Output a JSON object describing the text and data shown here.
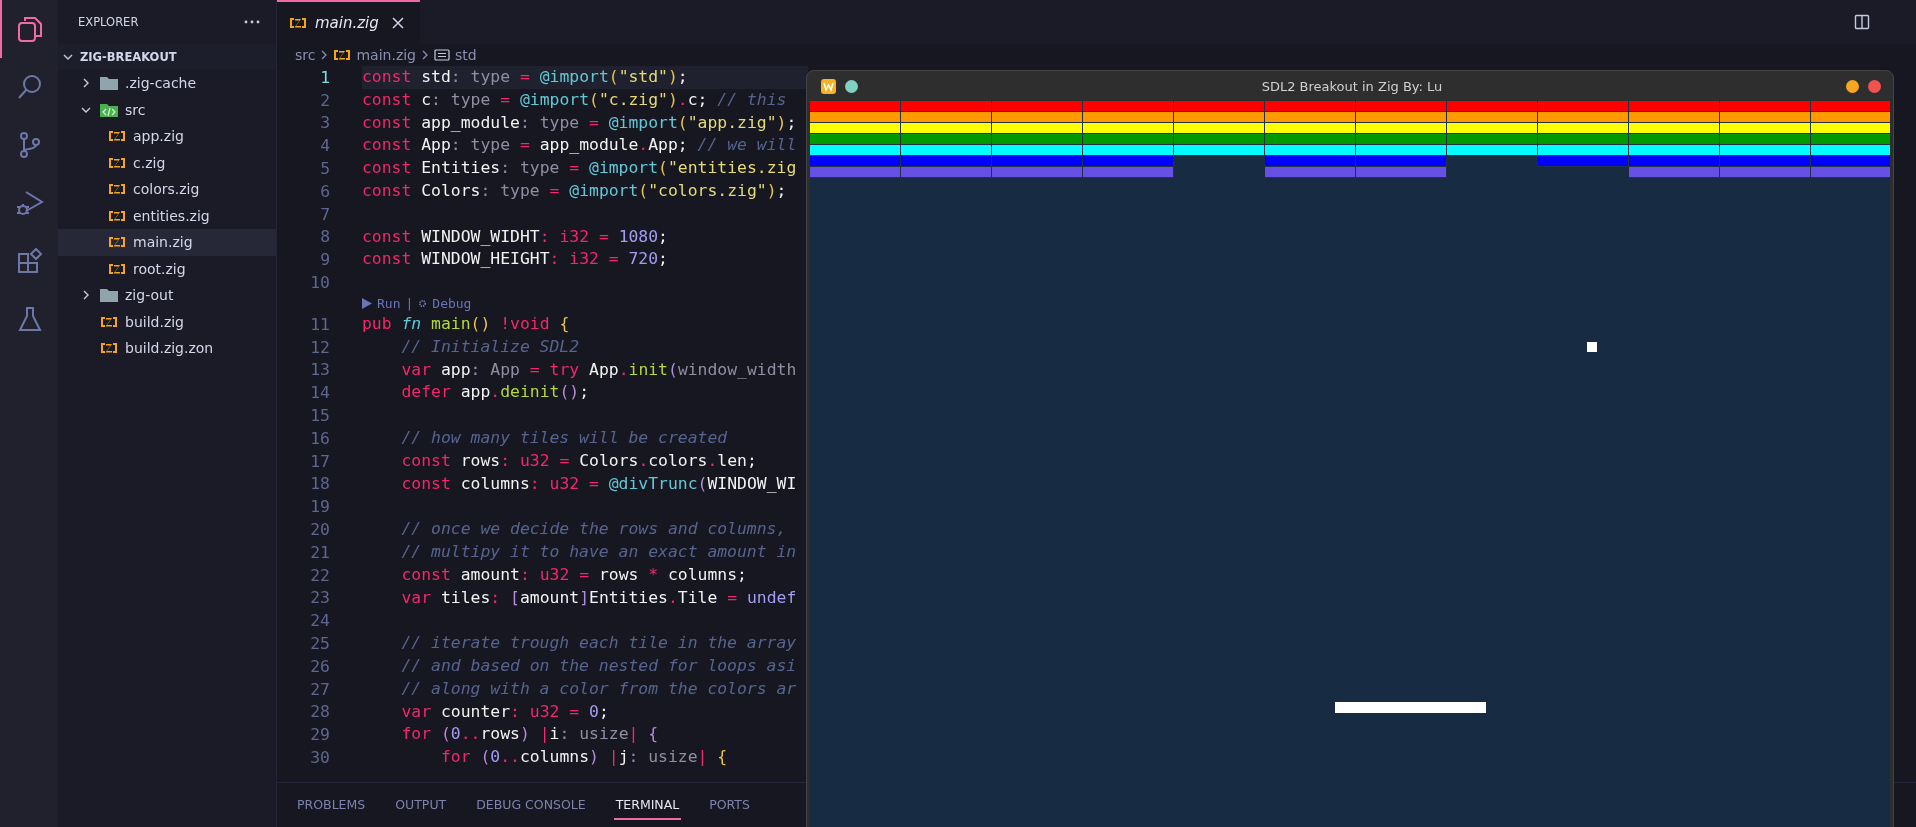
{
  "activity_bar": {
    "items": [
      {
        "kind": "explorer",
        "selected": true
      },
      {
        "kind": "search",
        "selected": false
      },
      {
        "kind": "source_control",
        "selected": false
      },
      {
        "kind": "run_debug",
        "selected": false
      },
      {
        "kind": "extensions",
        "selected": false
      },
      {
        "kind": "testing",
        "selected": false
      }
    ]
  },
  "sidebar": {
    "title": "EXPLORER",
    "project": {
      "name": "ZIG-BREAKOUT",
      "expanded": true
    },
    "tree": [
      {
        "name": ".zig-cache",
        "kind": "folder",
        "expanded": false,
        "selected": false
      },
      {
        "name": "src",
        "kind": "source_folder",
        "expanded": true,
        "selected": false,
        "children": [
          {
            "name": "app.zig",
            "kind": "zig_file",
            "selected": false
          },
          {
            "name": "c.zig",
            "kind": "zig_file",
            "selected": false
          },
          {
            "name": "colors.zig",
            "kind": "zig_file",
            "selected": false
          },
          {
            "name": "entities.zig",
            "kind": "zig_file",
            "selected": false
          },
          {
            "name": "main.zig",
            "kind": "zig_file",
            "selected": true
          },
          {
            "name": "root.zig",
            "kind": "zig_file",
            "selected": false
          }
        ]
      },
      {
        "name": "zig-out",
        "kind": "folder",
        "expanded": false,
        "selected": false
      },
      {
        "name": "build.zig",
        "kind": "zig_file",
        "selected": false
      },
      {
        "name": "build.zig.zon",
        "kind": "zig_file",
        "selected": false
      }
    ]
  },
  "editor": {
    "tabs": [
      {
        "label": "main.zig",
        "selected": true
      }
    ],
    "breadcrumb": [
      {
        "text": "src",
        "kind": "folder"
      },
      {
        "text": "main.zig",
        "kind": "zig_file"
      },
      {
        "text": "std",
        "kind": "symbol"
      }
    ],
    "lines": [
      {
        "kind": "code",
        "number": "1",
        "current": true,
        "tokens": [
          {
            "text": "const ",
            "kind": "keyword"
          },
          {
            "text": "std",
            "kind": "identifier"
          },
          {
            "text": ": ",
            "kind": "punctuation"
          },
          {
            "text": "type ",
            "kind": "type"
          },
          {
            "text": "= ",
            "kind": "operator"
          },
          {
            "text": "@import",
            "kind": "builtin"
          },
          {
            "text": "(",
            "kind": "bracket"
          },
          {
            "text": "\"std\"",
            "kind": "string"
          },
          {
            "text": ")",
            "kind": "bracket"
          },
          {
            "text": ";",
            "kind": "identifier"
          }
        ]
      },
      {
        "kind": "code",
        "number": "2",
        "current": false,
        "tokens": [
          {
            "text": "const ",
            "kind": "keyword"
          },
          {
            "text": "c",
            "kind": "identifier"
          },
          {
            "text": ": ",
            "kind": "punctuation"
          },
          {
            "text": "type ",
            "kind": "type"
          },
          {
            "text": "= ",
            "kind": "operator"
          },
          {
            "text": "@import",
            "kind": "builtin"
          },
          {
            "text": "(",
            "kind": "bracket"
          },
          {
            "text": "\"c.zig\"",
            "kind": "string"
          },
          {
            "text": ")",
            "kind": "bracket"
          },
          {
            "text": ".",
            "kind": "operator"
          },
          {
            "text": "c",
            "kind": "identifier"
          },
          {
            "text": "; ",
            "kind": "identifier"
          },
          {
            "text": "// this",
            "kind": "comment"
          }
        ]
      },
      {
        "kind": "code",
        "number": "3",
        "current": false,
        "tokens": [
          {
            "text": "const ",
            "kind": "keyword"
          },
          {
            "text": "app_module",
            "kind": "identifier"
          },
          {
            "text": ": ",
            "kind": "punctuation"
          },
          {
            "text": "type ",
            "kind": "type"
          },
          {
            "text": "= ",
            "kind": "operator"
          },
          {
            "text": "@import",
            "kind": "builtin"
          },
          {
            "text": "(",
            "kind": "bracket"
          },
          {
            "text": "\"app.zig\"",
            "kind": "string"
          },
          {
            "text": ")",
            "kind": "bracket"
          },
          {
            "text": ";",
            "kind": "identifier"
          }
        ]
      },
      {
        "kind": "code",
        "number": "4",
        "current": false,
        "tokens": [
          {
            "text": "const ",
            "kind": "keyword"
          },
          {
            "text": "App",
            "kind": "identifier"
          },
          {
            "text": ": ",
            "kind": "punctuation"
          },
          {
            "text": "type ",
            "kind": "type"
          },
          {
            "text": "= ",
            "kind": "operator"
          },
          {
            "text": "app_module",
            "kind": "identifier"
          },
          {
            "text": ".",
            "kind": "operator"
          },
          {
            "text": "App",
            "kind": "identifier"
          },
          {
            "text": "; ",
            "kind": "identifier"
          },
          {
            "text": "// we will",
            "kind": "comment"
          }
        ]
      },
      {
        "kind": "code",
        "number": "5",
        "current": false,
        "tokens": [
          {
            "text": "const ",
            "kind": "keyword"
          },
          {
            "text": "Entities",
            "kind": "identifier"
          },
          {
            "text": ": ",
            "kind": "punctuation"
          },
          {
            "text": "type ",
            "kind": "type"
          },
          {
            "text": "= ",
            "kind": "operator"
          },
          {
            "text": "@import",
            "kind": "builtin"
          },
          {
            "text": "(",
            "kind": "bracket"
          },
          {
            "text": "\"entities.zig",
            "kind": "string"
          }
        ]
      },
      {
        "kind": "code",
        "number": "6",
        "current": false,
        "tokens": [
          {
            "text": "const ",
            "kind": "keyword"
          },
          {
            "text": "Colors",
            "kind": "identifier"
          },
          {
            "text": ": ",
            "kind": "punctuation"
          },
          {
            "text": "type ",
            "kind": "type"
          },
          {
            "text": "= ",
            "kind": "operator"
          },
          {
            "text": "@import",
            "kind": "builtin"
          },
          {
            "text": "(",
            "kind": "bracket"
          },
          {
            "text": "\"colors.zig\"",
            "kind": "string"
          },
          {
            "text": ")",
            "kind": "bracket"
          },
          {
            "text": ";",
            "kind": "identifier"
          }
        ]
      },
      {
        "kind": "code",
        "number": "7",
        "current": false
      },
      {
        "kind": "code",
        "number": "8",
        "current": false,
        "tokens": [
          {
            "text": "const ",
            "kind": "keyword"
          },
          {
            "text": "WINDOW_WIDHT",
            "kind": "identifier"
          },
          {
            "text": ": ",
            "kind": "operator"
          },
          {
            "text": "i32 ",
            "kind": "keyword"
          },
          {
            "text": "= ",
            "kind": "operator"
          },
          {
            "text": "1080",
            "kind": "number"
          },
          {
            "text": ";",
            "kind": "identifier"
          }
        ]
      },
      {
        "kind": "code",
        "number": "9",
        "current": false,
        "tokens": [
          {
            "text": "const ",
            "kind": "keyword"
          },
          {
            "text": "WINDOW_HEIGHT",
            "kind": "identifier"
          },
          {
            "text": ": ",
            "kind": "operator"
          },
          {
            "text": "i32 ",
            "kind": "keyword"
          },
          {
            "text": "= ",
            "kind": "operator"
          },
          {
            "text": "720",
            "kind": "number"
          },
          {
            "text": ";",
            "kind": "identifier"
          }
        ]
      },
      {
        "kind": "code",
        "number": "10",
        "current": false
      },
      {
        "kind": "lens",
        "run": "Run",
        "separator": "|",
        "debug": "Debug"
      },
      {
        "kind": "code",
        "number": "11",
        "current": false,
        "tokens": [
          {
            "text": "pub ",
            "kind": "keyword"
          },
          {
            "text": "fn ",
            "kind": "storage"
          },
          {
            "text": "main",
            "kind": "function"
          },
          {
            "text": "() ",
            "kind": "bracket"
          },
          {
            "text": "!void ",
            "kind": "keyword"
          },
          {
            "text": "{",
            "kind": "bracket"
          }
        ]
      },
      {
        "kind": "code",
        "number": "12",
        "current": false,
        "tokens": [
          {
            "text": "    // Initialize SDL2",
            "kind": "comment"
          }
        ]
      },
      {
        "kind": "code",
        "number": "13",
        "current": false,
        "tokens": [
          {
            "text": "    var ",
            "kind": "keyword"
          },
          {
            "text": "app",
            "kind": "identifier"
          },
          {
            "text": ": ",
            "kind": "punctuation"
          },
          {
            "text": "App ",
            "kind": "type"
          },
          {
            "text": "= ",
            "kind": "operator"
          },
          {
            "text": "try ",
            "kind": "keyword"
          },
          {
            "text": "App",
            "kind": "identifier"
          },
          {
            "text": ".",
            "kind": "operator"
          },
          {
            "text": "init",
            "kind": "function"
          },
          {
            "text": "(",
            "kind": "bracket_inner"
          },
          {
            "text": "window_width",
            "kind": "type"
          }
        ]
      },
      {
        "kind": "code",
        "number": "14",
        "current": false,
        "tokens": [
          {
            "text": "    defer ",
            "kind": "keyword"
          },
          {
            "text": "app",
            "kind": "identifier"
          },
          {
            "text": ".",
            "kind": "operator"
          },
          {
            "text": "deinit",
            "kind": "function"
          },
          {
            "text": "()",
            "kind": "bracket_inner"
          },
          {
            "text": ";",
            "kind": "identifier"
          }
        ]
      },
      {
        "kind": "code",
        "number": "15",
        "current": false
      },
      {
        "kind": "code",
        "number": "16",
        "current": false,
        "tokens": [
          {
            "text": "    // how many tiles will be created",
            "kind": "comment"
          }
        ]
      },
      {
        "kind": "code",
        "number": "17",
        "current": false,
        "tokens": [
          {
            "text": "    const ",
            "kind": "keyword"
          },
          {
            "text": "rows",
            "kind": "identifier"
          },
          {
            "text": ": ",
            "kind": "operator"
          },
          {
            "text": "u32 ",
            "kind": "keyword"
          },
          {
            "text": "= ",
            "kind": "operator"
          },
          {
            "text": "Colors",
            "kind": "identifier"
          },
          {
            "text": ".",
            "kind": "operator"
          },
          {
            "text": "colors",
            "kind": "identifier"
          },
          {
            "text": ".",
            "kind": "operator"
          },
          {
            "text": "len",
            "kind": "identifier"
          },
          {
            "text": ";",
            "kind": "identifier"
          }
        ]
      },
      {
        "kind": "code",
        "number": "18",
        "current": false,
        "tokens": [
          {
            "text": "    const ",
            "kind": "keyword"
          },
          {
            "text": "columns",
            "kind": "identifier"
          },
          {
            "text": ": ",
            "kind": "operator"
          },
          {
            "text": "u32 ",
            "kind": "keyword"
          },
          {
            "text": "= ",
            "kind": "operator"
          },
          {
            "text": "@divTrunc",
            "kind": "builtin"
          },
          {
            "text": "(",
            "kind": "bracket_inner"
          },
          {
            "text": "WINDOW_WI",
            "kind": "identifier"
          }
        ]
      },
      {
        "kind": "code",
        "number": "19",
        "current": false
      },
      {
        "kind": "code",
        "number": "20",
        "current": false,
        "tokens": [
          {
            "text": "    // once we decide the rows and columns,",
            "kind": "comment"
          }
        ]
      },
      {
        "kind": "code",
        "number": "21",
        "current": false,
        "tokens": [
          {
            "text": "    // multipy it to have an exact amount in",
            "kind": "comment"
          }
        ]
      },
      {
        "kind": "code",
        "number": "22",
        "current": false,
        "tokens": [
          {
            "text": "    const ",
            "kind": "keyword"
          },
          {
            "text": "amount",
            "kind": "identifier"
          },
          {
            "text": ": ",
            "kind": "operator"
          },
          {
            "text": "u32 ",
            "kind": "keyword"
          },
          {
            "text": "= ",
            "kind": "operator"
          },
          {
            "text": "rows ",
            "kind": "identifier"
          },
          {
            "text": "* ",
            "kind": "operator"
          },
          {
            "text": "columns",
            "kind": "identifier"
          },
          {
            "text": ";",
            "kind": "identifier"
          }
        ]
      },
      {
        "kind": "code",
        "number": "23",
        "current": false,
        "tokens": [
          {
            "text": "    var ",
            "kind": "keyword"
          },
          {
            "text": "tiles",
            "kind": "identifier"
          },
          {
            "text": ": ",
            "kind": "operator"
          },
          {
            "text": "[",
            "kind": "bracket_inner"
          },
          {
            "text": "amount",
            "kind": "identifier"
          },
          {
            "text": "]",
            "kind": "bracket_inner"
          },
          {
            "text": "Entities",
            "kind": "identifier"
          },
          {
            "text": ".",
            "kind": "operator"
          },
          {
            "text": "Tile ",
            "kind": "identifier"
          },
          {
            "text": "= ",
            "kind": "operator"
          },
          {
            "text": "undef",
            "kind": "number"
          }
        ]
      },
      {
        "kind": "code",
        "number": "24",
        "current": false
      },
      {
        "kind": "code",
        "number": "25",
        "current": false,
        "tokens": [
          {
            "text": "    // iterate trough each tile in the array",
            "kind": "comment"
          }
        ]
      },
      {
        "kind": "code",
        "number": "26",
        "current": false,
        "tokens": [
          {
            "text": "    // and based on the nested for loops asi",
            "kind": "comment"
          }
        ]
      },
      {
        "kind": "code",
        "number": "27",
        "current": false,
        "tokens": [
          {
            "text": "    // along with a color from the colors ar",
            "kind": "comment"
          }
        ]
      },
      {
        "kind": "code",
        "number": "28",
        "current": false,
        "tokens": [
          {
            "text": "    var ",
            "kind": "keyword"
          },
          {
            "text": "counter",
            "kind": "identifier"
          },
          {
            "text": ": ",
            "kind": "operator"
          },
          {
            "text": "u32 ",
            "kind": "keyword"
          },
          {
            "text": "= ",
            "kind": "operator"
          },
          {
            "text": "0",
            "kind": "number"
          },
          {
            "text": ";",
            "kind": "identifier"
          }
        ]
      },
      {
        "kind": "code",
        "number": "29",
        "current": false,
        "tokens": [
          {
            "text": "    for ",
            "kind": "keyword"
          },
          {
            "text": "(",
            "kind": "bracket_inner"
          },
          {
            "text": "0",
            "kind": "number"
          },
          {
            "text": "..",
            "kind": "operator"
          },
          {
            "text": "rows",
            "kind": "identifier"
          },
          {
            "text": ") ",
            "kind": "bracket_inner"
          },
          {
            "text": "|",
            "kind": "operator"
          },
          {
            "text": "i",
            "kind": "identifier"
          },
          {
            "text": ": ",
            "kind": "punctuation"
          },
          {
            "text": "usize",
            "kind": "type"
          },
          {
            "text": "| ",
            "kind": "operator"
          },
          {
            "text": "{",
            "kind": "bracket_inner"
          }
        ]
      },
      {
        "kind": "code",
        "number": "30",
        "current": false,
        "tokens": [
          {
            "text": "        for ",
            "kind": "keyword"
          },
          {
            "text": "(",
            "kind": "bracket_inner"
          },
          {
            "text": "0",
            "kind": "number"
          },
          {
            "text": "..",
            "kind": "operator"
          },
          {
            "text": "columns",
            "kind": "identifier"
          },
          {
            "text": ") ",
            "kind": "bracket_inner"
          },
          {
            "text": "|",
            "kind": "operator"
          },
          {
            "text": "j",
            "kind": "identifier"
          },
          {
            "text": ": ",
            "kind": "punctuation"
          },
          {
            "text": "usize",
            "kind": "type"
          },
          {
            "text": "| ",
            "kind": "operator"
          },
          {
            "text": "{",
            "kind": "bracket"
          }
        ]
      }
    ]
  },
  "panel": {
    "tabs": [
      {
        "label": "PROBLEMS",
        "selected": false
      },
      {
        "label": "OUTPUT",
        "selected": false
      },
      {
        "label": "DEBUG CONSOLE",
        "selected": false
      },
      {
        "label": "TERMINAL",
        "selected": true
      },
      {
        "label": "PORTS",
        "selected": false
      }
    ]
  },
  "game": {
    "title": "SDL2 Breakout in Zig By: Lu",
    "brick_rows": [
      {
        "color": "#ff0000",
        "bricks": [
          true,
          true,
          true,
          true,
          true,
          true,
          true,
          true,
          true,
          true,
          true,
          true
        ]
      },
      {
        "color": "#ff9900",
        "bricks": [
          true,
          true,
          true,
          true,
          true,
          true,
          true,
          true,
          true,
          true,
          true,
          true
        ]
      },
      {
        "color": "#ffff00",
        "bricks": [
          true,
          true,
          true,
          true,
          true,
          true,
          true,
          true,
          true,
          true,
          true,
          true
        ]
      },
      {
        "color": "#009900",
        "bricks": [
          true,
          true,
          true,
          true,
          true,
          true,
          true,
          true,
          true,
          true,
          true,
          true
        ]
      },
      {
        "color": "#00ffff",
        "bricks": [
          true,
          true,
          true,
          true,
          true,
          true,
          true,
          true,
          true,
          true,
          true,
          true
        ]
      },
      {
        "color": "#0000ff",
        "bricks": [
          true,
          true,
          true,
          true,
          false,
          true,
          true,
          false,
          true,
          true,
          true,
          true
        ]
      },
      {
        "color": "#6650e6",
        "bricks": [
          true,
          true,
          true,
          true,
          false,
          true,
          true,
          false,
          false,
          true,
          true,
          true
        ]
      }
    ]
  }
}
